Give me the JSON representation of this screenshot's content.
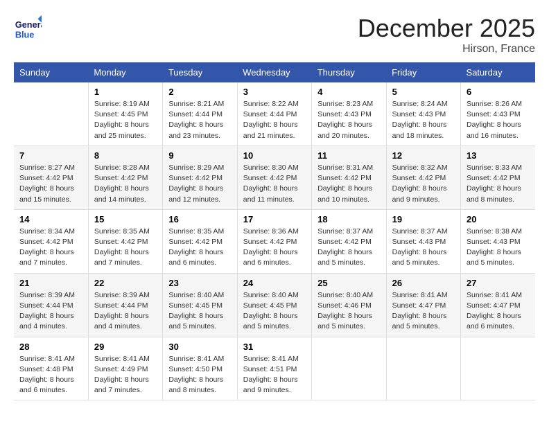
{
  "logo": {
    "general": "General",
    "blue": "Blue"
  },
  "title": "December 2025",
  "location": "Hirson, France",
  "days_header": [
    "Sunday",
    "Monday",
    "Tuesday",
    "Wednesday",
    "Thursday",
    "Friday",
    "Saturday"
  ],
  "weeks": [
    [
      {
        "day": "",
        "sunrise": "",
        "sunset": "",
        "daylight": ""
      },
      {
        "day": "1",
        "sunrise": "Sunrise: 8:19 AM",
        "sunset": "Sunset: 4:45 PM",
        "daylight": "Daylight: 8 hours and 25 minutes."
      },
      {
        "day": "2",
        "sunrise": "Sunrise: 8:21 AM",
        "sunset": "Sunset: 4:44 PM",
        "daylight": "Daylight: 8 hours and 23 minutes."
      },
      {
        "day": "3",
        "sunrise": "Sunrise: 8:22 AM",
        "sunset": "Sunset: 4:44 PM",
        "daylight": "Daylight: 8 hours and 21 minutes."
      },
      {
        "day": "4",
        "sunrise": "Sunrise: 8:23 AM",
        "sunset": "Sunset: 4:43 PM",
        "daylight": "Daylight: 8 hours and 20 minutes."
      },
      {
        "day": "5",
        "sunrise": "Sunrise: 8:24 AM",
        "sunset": "Sunset: 4:43 PM",
        "daylight": "Daylight: 8 hours and 18 minutes."
      },
      {
        "day": "6",
        "sunrise": "Sunrise: 8:26 AM",
        "sunset": "Sunset: 4:43 PM",
        "daylight": "Daylight: 8 hours and 16 minutes."
      }
    ],
    [
      {
        "day": "7",
        "sunrise": "Sunrise: 8:27 AM",
        "sunset": "Sunset: 4:42 PM",
        "daylight": "Daylight: 8 hours and 15 minutes."
      },
      {
        "day": "8",
        "sunrise": "Sunrise: 8:28 AM",
        "sunset": "Sunset: 4:42 PM",
        "daylight": "Daylight: 8 hours and 14 minutes."
      },
      {
        "day": "9",
        "sunrise": "Sunrise: 8:29 AM",
        "sunset": "Sunset: 4:42 PM",
        "daylight": "Daylight: 8 hours and 12 minutes."
      },
      {
        "day": "10",
        "sunrise": "Sunrise: 8:30 AM",
        "sunset": "Sunset: 4:42 PM",
        "daylight": "Daylight: 8 hours and 11 minutes."
      },
      {
        "day": "11",
        "sunrise": "Sunrise: 8:31 AM",
        "sunset": "Sunset: 4:42 PM",
        "daylight": "Daylight: 8 hours and 10 minutes."
      },
      {
        "day": "12",
        "sunrise": "Sunrise: 8:32 AM",
        "sunset": "Sunset: 4:42 PM",
        "daylight": "Daylight: 8 hours and 9 minutes."
      },
      {
        "day": "13",
        "sunrise": "Sunrise: 8:33 AM",
        "sunset": "Sunset: 4:42 PM",
        "daylight": "Daylight: 8 hours and 8 minutes."
      }
    ],
    [
      {
        "day": "14",
        "sunrise": "Sunrise: 8:34 AM",
        "sunset": "Sunset: 4:42 PM",
        "daylight": "Daylight: 8 hours and 7 minutes."
      },
      {
        "day": "15",
        "sunrise": "Sunrise: 8:35 AM",
        "sunset": "Sunset: 4:42 PM",
        "daylight": "Daylight: 8 hours and 7 minutes."
      },
      {
        "day": "16",
        "sunrise": "Sunrise: 8:35 AM",
        "sunset": "Sunset: 4:42 PM",
        "daylight": "Daylight: 8 hours and 6 minutes."
      },
      {
        "day": "17",
        "sunrise": "Sunrise: 8:36 AM",
        "sunset": "Sunset: 4:42 PM",
        "daylight": "Daylight: 8 hours and 6 minutes."
      },
      {
        "day": "18",
        "sunrise": "Sunrise: 8:37 AM",
        "sunset": "Sunset: 4:42 PM",
        "daylight": "Daylight: 8 hours and 5 minutes."
      },
      {
        "day": "19",
        "sunrise": "Sunrise: 8:37 AM",
        "sunset": "Sunset: 4:43 PM",
        "daylight": "Daylight: 8 hours and 5 minutes."
      },
      {
        "day": "20",
        "sunrise": "Sunrise: 8:38 AM",
        "sunset": "Sunset: 4:43 PM",
        "daylight": "Daylight: 8 hours and 5 minutes."
      }
    ],
    [
      {
        "day": "21",
        "sunrise": "Sunrise: 8:39 AM",
        "sunset": "Sunset: 4:44 PM",
        "daylight": "Daylight: 8 hours and 4 minutes."
      },
      {
        "day": "22",
        "sunrise": "Sunrise: 8:39 AM",
        "sunset": "Sunset: 4:44 PM",
        "daylight": "Daylight: 8 hours and 4 minutes."
      },
      {
        "day": "23",
        "sunrise": "Sunrise: 8:40 AM",
        "sunset": "Sunset: 4:45 PM",
        "daylight": "Daylight: 8 hours and 5 minutes."
      },
      {
        "day": "24",
        "sunrise": "Sunrise: 8:40 AM",
        "sunset": "Sunset: 4:45 PM",
        "daylight": "Daylight: 8 hours and 5 minutes."
      },
      {
        "day": "25",
        "sunrise": "Sunrise: 8:40 AM",
        "sunset": "Sunset: 4:46 PM",
        "daylight": "Daylight: 8 hours and 5 minutes."
      },
      {
        "day": "26",
        "sunrise": "Sunrise: 8:41 AM",
        "sunset": "Sunset: 4:47 PM",
        "daylight": "Daylight: 8 hours and 5 minutes."
      },
      {
        "day": "27",
        "sunrise": "Sunrise: 8:41 AM",
        "sunset": "Sunset: 4:47 PM",
        "daylight": "Daylight: 8 hours and 6 minutes."
      }
    ],
    [
      {
        "day": "28",
        "sunrise": "Sunrise: 8:41 AM",
        "sunset": "Sunset: 4:48 PM",
        "daylight": "Daylight: 8 hours and 6 minutes."
      },
      {
        "day": "29",
        "sunrise": "Sunrise: 8:41 AM",
        "sunset": "Sunset: 4:49 PM",
        "daylight": "Daylight: 8 hours and 7 minutes."
      },
      {
        "day": "30",
        "sunrise": "Sunrise: 8:41 AM",
        "sunset": "Sunset: 4:50 PM",
        "daylight": "Daylight: 8 hours and 8 minutes."
      },
      {
        "day": "31",
        "sunrise": "Sunrise: 8:41 AM",
        "sunset": "Sunset: 4:51 PM",
        "daylight": "Daylight: 8 hours and 9 minutes."
      },
      {
        "day": "",
        "sunrise": "",
        "sunset": "",
        "daylight": ""
      },
      {
        "day": "",
        "sunrise": "",
        "sunset": "",
        "daylight": ""
      },
      {
        "day": "",
        "sunrise": "",
        "sunset": "",
        "daylight": ""
      }
    ]
  ]
}
